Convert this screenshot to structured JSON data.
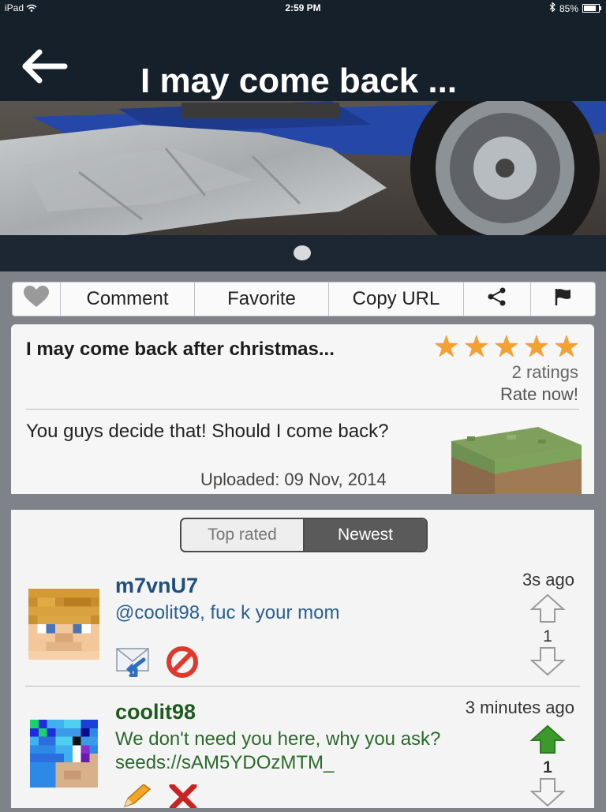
{
  "status": {
    "device": "iPad",
    "time": "2:59 PM",
    "battery": "85%"
  },
  "nav": {
    "title": "I may come back ..."
  },
  "toolbar": {
    "comment": "Comment",
    "favorite": "Favorite",
    "copy_url": "Copy URL"
  },
  "post": {
    "title": "I may come back after christmas...",
    "rating_stars": 5,
    "ratings_count": "2 ratings",
    "rate_now": "Rate now!",
    "description": "You guys decide that! Should I come back?",
    "uploaded": "Uploaded: 09 Nov, 2014"
  },
  "sort": {
    "top_rated": "Top rated",
    "newest": "Newest",
    "selected": "Newest"
  },
  "comments": [
    {
      "user": "m7vnU7",
      "text": "@coolit98, fuc k your mom",
      "time": "3s ago",
      "votes": "1",
      "user_color": "#1f4f7c",
      "text_color": "#2a5f8f"
    },
    {
      "user": "coolit98",
      "text_line1": "We don't need you here, why you ask?",
      "text_line2": "seeds://sAM5YDOzMTM_",
      "time": "3 minutes ago",
      "votes": "1",
      "user_color": "#1e5a1e",
      "text_color": "#2a6a2a"
    }
  ],
  "colors": {
    "nav_bg": "#16202b",
    "star": "#f5a12f",
    "upvote_active": "#3c9a2c"
  }
}
